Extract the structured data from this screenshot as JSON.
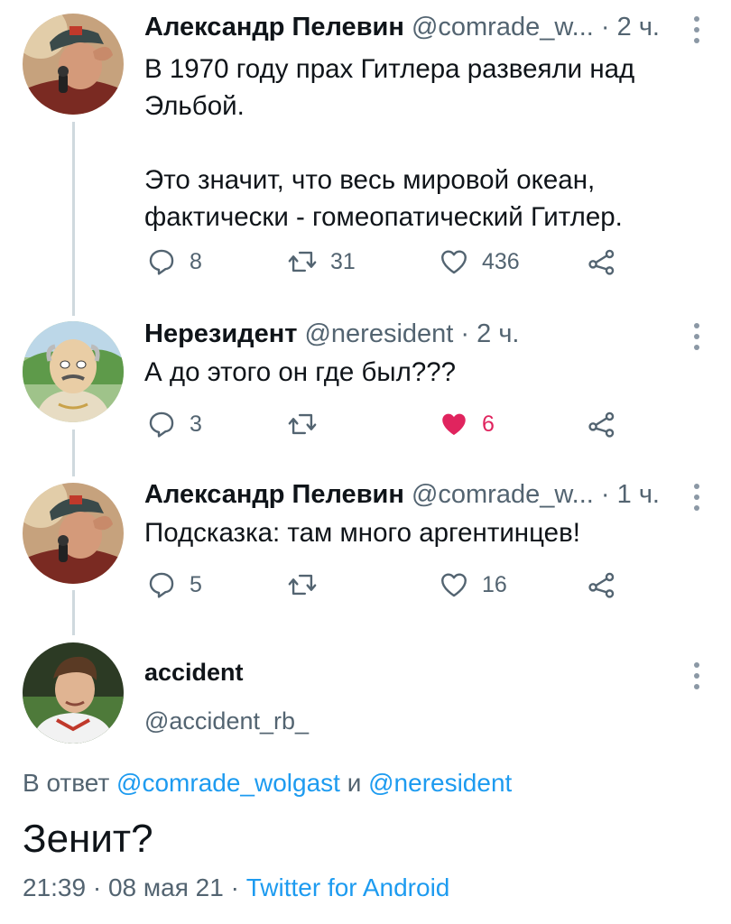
{
  "tweets": [
    {
      "name": "Александр Пелевин",
      "handle": "@comrade_w...",
      "time": "· 2 ч.",
      "text": "В 1970 году прах Гитлера развеяли над Эльбой.\n\nЭто значит, что весь мировой океан, фактически - гомеопатический Гитлер.",
      "replies": "8",
      "retweets": "31",
      "likes": "436",
      "liked": false,
      "avatar": "portrait-man-microphone"
    },
    {
      "name": "Нерезидент",
      "handle": "@neresident",
      "time": "· 2 ч.",
      "text": "А до этого он где был???",
      "replies": "3",
      "retweets": "",
      "likes": "6",
      "liked": true,
      "avatar": "cartoon-bald-man"
    },
    {
      "name": "Александр Пелевин",
      "handle": "@comrade_w...",
      "time": "· 1 ч.",
      "text": "Подсказка: там много аргентинцев!",
      "replies": "5",
      "retweets": "",
      "likes": "16",
      "liked": false,
      "avatar": "portrait-man-microphone"
    }
  ],
  "main_tweet": {
    "name": "accident",
    "handle": "@accident_rb_",
    "reply_prefix": "В ответ",
    "reply_user1": "@comrade_wolgast",
    "reply_and": "и",
    "reply_user2": "@neresident",
    "text": "Зенит?",
    "time": "21:39",
    "date": "08 мая 21",
    "source": "Twitter for Android"
  },
  "colors": {
    "text": "#0f1419",
    "secondary": "#536471",
    "link": "#1d9bf0",
    "like": "#e0245e",
    "thread_line": "#cfd9de"
  }
}
